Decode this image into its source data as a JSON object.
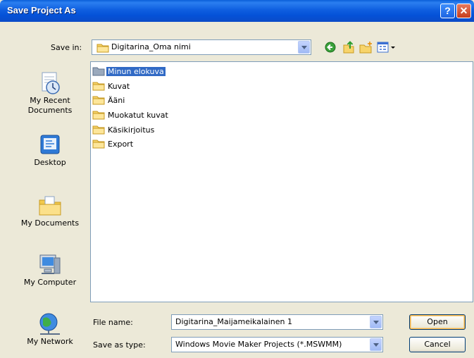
{
  "window": {
    "title": "Save Project As",
    "help_glyph": "?",
    "close_glyph": "✕"
  },
  "savein": {
    "label": "Save in:",
    "value": "Digitarina_Oma nimi"
  },
  "toolbar": {
    "icons": [
      "back-icon",
      "up-folder-icon",
      "new-folder-icon",
      "views-menu-icon"
    ]
  },
  "places": [
    {
      "label": "My Recent Documents",
      "icon": "recent-documents-icon"
    },
    {
      "label": "Desktop",
      "icon": "desktop-icon"
    },
    {
      "label": "My Documents",
      "icon": "my-documents-icon"
    },
    {
      "label": "My Computer",
      "icon": "my-computer-icon"
    },
    {
      "label": "My Network",
      "icon": "my-network-icon"
    }
  ],
  "files": [
    {
      "name": "Minun elokuva",
      "selected": true
    },
    {
      "name": "Kuvat",
      "selected": false
    },
    {
      "name": "Ääni",
      "selected": false
    },
    {
      "name": "Muokatut kuvat",
      "selected": false
    },
    {
      "name": "Käsikirjoitus",
      "selected": false
    },
    {
      "name": "Export",
      "selected": false
    }
  ],
  "filename": {
    "label": "File name:",
    "value": "Digitarina_Maijameikalainen 1"
  },
  "savetype": {
    "label": "Save as type:",
    "value": "Windows Movie Maker Projects (*.MSWMM)"
  },
  "buttons": {
    "open": "Open",
    "cancel": "Cancel"
  },
  "colors": {
    "titlebar": "#0552d8",
    "selection": "#316ac5",
    "dialog_bg": "#ece9d8"
  }
}
